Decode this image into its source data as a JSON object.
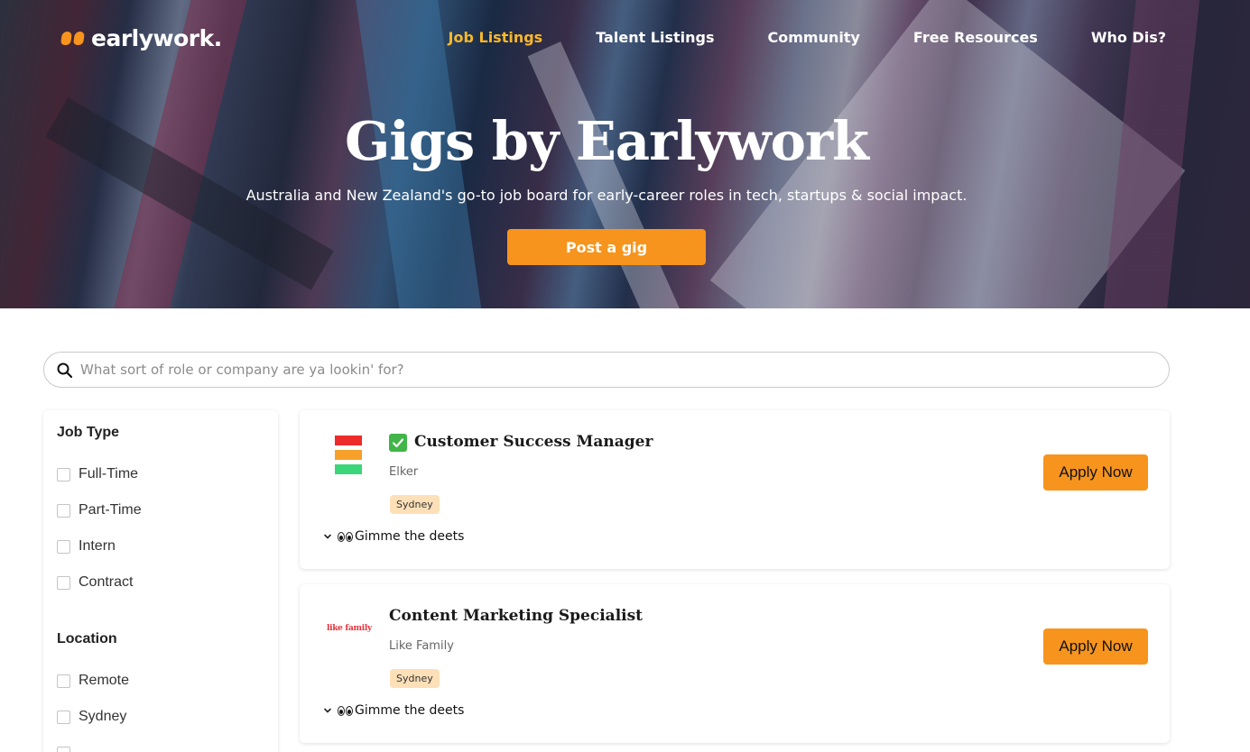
{
  "header": {
    "logo_text": "earlywork.",
    "nav": [
      {
        "label": "Job Listings",
        "active": true
      },
      {
        "label": "Talent Listings"
      },
      {
        "label": "Community"
      },
      {
        "label": "Free Resources"
      },
      {
        "label": "Who Dis?"
      }
    ]
  },
  "hero": {
    "title": "Gigs by Earlywork",
    "subtitle": "Australia and New Zealand's go-to job board for early-career roles in tech, startups & social impact.",
    "cta_label": "Post a gig"
  },
  "search": {
    "placeholder": "What sort of role or company are ya lookin' for?",
    "value": ""
  },
  "filters": {
    "job_type": {
      "title": "Job Type",
      "options": [
        "Full-Time",
        "Part-Time",
        "Intern",
        "Contract"
      ]
    },
    "location": {
      "title": "Location",
      "options": [
        "Remote",
        "Sydney"
      ]
    }
  },
  "jobs": [
    {
      "title": "Customer Success Manager",
      "company": "Elker",
      "location": "Sydney",
      "details_label": "Gimme the deets",
      "apply_label": "Apply Now",
      "verified_icon": "check-mark-icon",
      "logo_colors": [
        "#ee2b2b",
        "#f7a12b",
        "#3bd67a"
      ]
    },
    {
      "title": "Content Marketing Specialist",
      "company": "Like Family",
      "location": "Sydney",
      "details_label": "Gimme the deets",
      "apply_label": "Apply Now",
      "logo_text": "like family"
    }
  ],
  "colors": {
    "accent": "#f7941d",
    "nav_active": "#f9b82c",
    "badge_bg": "#fde0b8"
  }
}
